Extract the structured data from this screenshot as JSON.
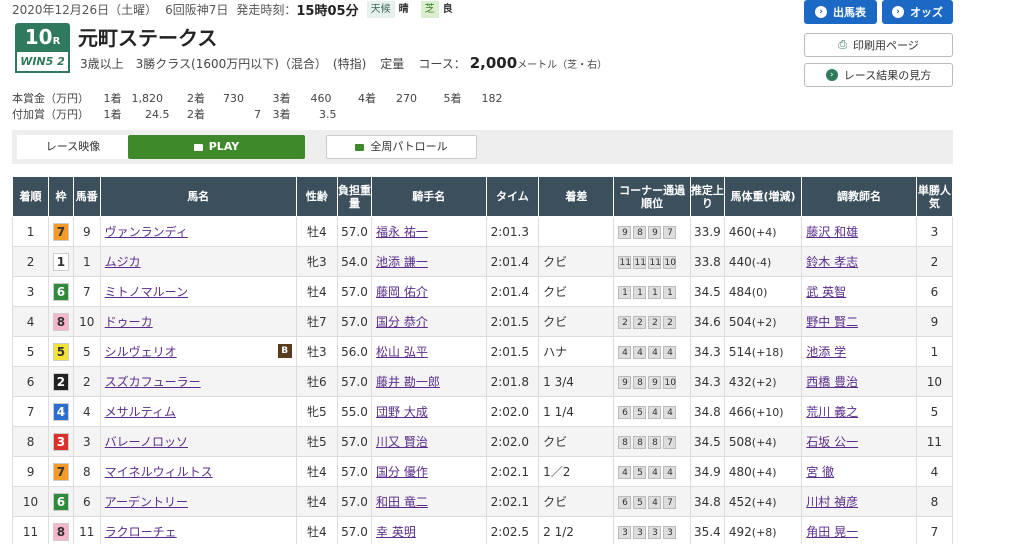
{
  "race_meta": {
    "date": "2020年12月26日（土曜）",
    "meeting": "6回阪神7日",
    "post_time_label": "発走時刻：",
    "post_time": "15時05分",
    "weather_label": "天候",
    "weather": "晴",
    "surface": "芝",
    "going": "良"
  },
  "race": {
    "number": "10",
    "number_suffix": "R",
    "win5_label": "WIN5",
    "win5_index": "2",
    "name": "元町ステークス",
    "conditions": "3歳以上　3勝クラス(1600万円以下)（混合）　(特指)",
    "weight_rule": "定量",
    "course_label": "コース：",
    "distance": "2,000",
    "distance_unit": "メートル（芝・右）"
  },
  "buttons": {
    "entries": "出馬表",
    "odds": "オッズ",
    "print": "印刷用ページ",
    "howto": "レース結果の見方"
  },
  "prizes": {
    "main_label": "本賞金（万円）",
    "main": [
      [
        "1着",
        "1,820"
      ],
      [
        "2着",
        "730"
      ],
      [
        "3着",
        "460"
      ],
      [
        "4着",
        "270"
      ],
      [
        "5着",
        "182"
      ]
    ],
    "extra_label": "付加賞（万円）",
    "extra": [
      [
        "1着",
        "24.5"
      ],
      [
        "2着",
        "7"
      ],
      [
        "3着",
        "3.5"
      ]
    ]
  },
  "video": {
    "label": "レース映像",
    "play": "PLAY",
    "patrol": "全周パトロール"
  },
  "table": {
    "headers": [
      "着順",
      "枠",
      "馬番",
      "馬名",
      "性齢",
      "負担重量",
      "騎手名",
      "タイム",
      "着差",
      "コーナー通過順位",
      "推定上り",
      "馬体重(増減)",
      "調教師名",
      "単勝人気"
    ],
    "rows": [
      {
        "rank": "1",
        "waku": "7",
        "num": "9",
        "horse": "ヴァンランディ",
        "sexage": "牡4",
        "weight": "57.0",
        "jockey": "福永 祐一",
        "time": "2:01.3",
        "margin": "",
        "corners": [
          "9",
          "8",
          "9",
          "7"
        ],
        "last3f": "33.9",
        "body": "460",
        "diff": "(+4)",
        "trainer": "藤沢 和雄",
        "pop": "3"
      },
      {
        "rank": "2",
        "waku": "1",
        "num": "1",
        "horse": "ムジカ",
        "sexage": "牝3",
        "weight": "54.0",
        "jockey": "池添 謙一",
        "time": "2:01.4",
        "margin": "クビ",
        "corners": [
          "11",
          "11",
          "11",
          "10"
        ],
        "last3f": "33.8",
        "body": "440",
        "diff": "(-4)",
        "trainer": "鈴木 孝志",
        "pop": "2"
      },
      {
        "rank": "3",
        "waku": "6",
        "num": "7",
        "horse": "ミトノマルーン",
        "sexage": "牡4",
        "weight": "57.0",
        "jockey": "藤岡 佑介",
        "time": "2:01.4",
        "margin": "クビ",
        "corners": [
          "1",
          "1",
          "1",
          "1"
        ],
        "last3f": "34.5",
        "body": "484",
        "diff": "(0)",
        "trainer": "武 英智",
        "pop": "6"
      },
      {
        "rank": "4",
        "waku": "8",
        "num": "10",
        "horse": "ドゥーカ",
        "sexage": "牡7",
        "weight": "57.0",
        "jockey": "国分 恭介",
        "time": "2:01.5",
        "margin": "クビ",
        "corners": [
          "2",
          "2",
          "2",
          "2"
        ],
        "last3f": "34.6",
        "body": "504",
        "diff": "(+2)",
        "trainer": "野中 賢二",
        "pop": "9"
      },
      {
        "rank": "5",
        "waku": "5",
        "num": "5",
        "horse": "シルヴェリオ",
        "blinker": "B",
        "sexage": "牡3",
        "weight": "56.0",
        "jockey": "松山 弘平",
        "time": "2:01.5",
        "margin": "ハナ",
        "corners": [
          "4",
          "4",
          "4",
          "4"
        ],
        "last3f": "34.3",
        "body": "514",
        "diff": "(+18)",
        "trainer": "池添 学",
        "pop": "1"
      },
      {
        "rank": "6",
        "waku": "2",
        "num": "2",
        "horse": "スズカフューラー",
        "sexage": "牡6",
        "weight": "57.0",
        "jockey": "藤井 勘一郎",
        "time": "2:01.8",
        "margin": "1 3/4",
        "corners": [
          "9",
          "8",
          "9",
          "10"
        ],
        "last3f": "34.3",
        "body": "432",
        "diff": "(+2)",
        "trainer": "西橋 豊治",
        "pop": "10"
      },
      {
        "rank": "7",
        "waku": "4",
        "num": "4",
        "horse": "メサルティム",
        "sexage": "牝5",
        "weight": "55.0",
        "jockey": "団野 大成",
        "time": "2:02.0",
        "margin": "1 1/4",
        "corners": [
          "6",
          "5",
          "4",
          "4"
        ],
        "last3f": "34.8",
        "body": "466",
        "diff": "(+10)",
        "trainer": "荒川 義之",
        "pop": "5"
      },
      {
        "rank": "8",
        "waku": "3",
        "num": "3",
        "horse": "バレーノロッソ",
        "sexage": "牡5",
        "weight": "57.0",
        "jockey": "川又 賢治",
        "time": "2:02.0",
        "margin": "クビ",
        "corners": [
          "8",
          "8",
          "8",
          "7"
        ],
        "last3f": "34.5",
        "body": "508",
        "diff": "(+4)",
        "trainer": "石坂 公一",
        "pop": "11"
      },
      {
        "rank": "9",
        "waku": "7",
        "num": "8",
        "horse": "マイネルウィルトス",
        "sexage": "牡4",
        "weight": "57.0",
        "jockey": "国分 優作",
        "time": "2:02.1",
        "margin": "1／2",
        "corners": [
          "4",
          "5",
          "4",
          "4"
        ],
        "last3f": "34.9",
        "body": "480",
        "diff": "(+4)",
        "trainer": "宮 徹",
        "pop": "4"
      },
      {
        "rank": "10",
        "waku": "6",
        "num": "6",
        "horse": "アーデントリー",
        "sexage": "牡4",
        "weight": "57.0",
        "jockey": "和田 竜二",
        "time": "2:02.1",
        "margin": "クビ",
        "corners": [
          "6",
          "5",
          "4",
          "7"
        ],
        "last3f": "34.8",
        "body": "452",
        "diff": "(+4)",
        "trainer": "川村 禎彦",
        "pop": "8"
      },
      {
        "rank": "11",
        "waku": "8",
        "num": "11",
        "horse": "ラクローチェ",
        "sexage": "牡4",
        "weight": "57.0",
        "jockey": "幸 英明",
        "time": "2:02.5",
        "margin": "2 1/2",
        "corners": [
          "3",
          "3",
          "3",
          "3"
        ],
        "last3f": "35.4",
        "body": "492",
        "diff": "(+8)",
        "trainer": "角田 晃一",
        "pop": "7"
      }
    ]
  },
  "waku_colors": {
    "1": [
      "#ffffff",
      "#333333"
    ],
    "2": [
      "#222222",
      "#ffffff"
    ],
    "3": [
      "#d9302c",
      "#ffffff"
    ],
    "4": [
      "#2a6fcf",
      "#ffffff"
    ],
    "5": [
      "#f3e23a",
      "#333333"
    ],
    "6": [
      "#2f8a3c",
      "#ffffff"
    ],
    "7": [
      "#f39a28",
      "#333333"
    ],
    "8": [
      "#f6b6c9",
      "#333333"
    ]
  }
}
